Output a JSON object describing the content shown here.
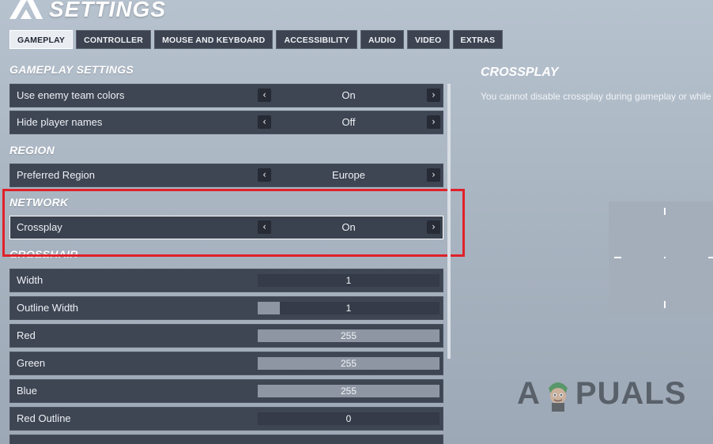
{
  "header": {
    "title": "SETTINGS",
    "logo_icon": "x-brand-logo-icon"
  },
  "tabs": [
    {
      "label": "GAMEPLAY",
      "active": true
    },
    {
      "label": "CONTROLLER",
      "active": false
    },
    {
      "label": "MOUSE AND KEYBOARD",
      "active": false
    },
    {
      "label": "ACCESSIBILITY",
      "active": false
    },
    {
      "label": "AUDIO",
      "active": false
    },
    {
      "label": "VIDEO",
      "active": false
    },
    {
      "label": "EXTRAS",
      "active": false
    }
  ],
  "sections": {
    "gameplay": "GAMEPLAY SETTINGS",
    "region": "REGION",
    "network": "NETWORK",
    "crosshair": "CROSSHAIR"
  },
  "settings": {
    "enemy_colors": {
      "label": "Use enemy team colors",
      "value": "On"
    },
    "hide_names": {
      "label": "Hide player names",
      "value": "Off"
    },
    "region": {
      "label": "Preferred Region",
      "value": "Europe"
    },
    "crossplay": {
      "label": "Crossplay",
      "value": "On"
    }
  },
  "crosshair_sliders": [
    {
      "label": "Width",
      "value": "1",
      "fraction": 0.0
    },
    {
      "label": "Outline Width",
      "value": "1",
      "fraction": 0.12
    },
    {
      "label": "Red",
      "value": "255",
      "fraction": 1.0
    },
    {
      "label": "Green",
      "value": "255",
      "fraction": 1.0
    },
    {
      "label": "Blue",
      "value": "255",
      "fraction": 1.0
    },
    {
      "label": "Red Outline",
      "value": "0",
      "fraction": 0.0
    }
  ],
  "info_panel": {
    "title": "CROSSPLAY",
    "text": "You cannot disable crossplay during gameplay or while mato"
  },
  "watermark": {
    "text_left": "A",
    "text_right": "PUALS"
  },
  "colors": {
    "highlight_box": "#e0212a",
    "row_bg": "#3e4553",
    "active_tab_bg": "#e9edf2"
  }
}
